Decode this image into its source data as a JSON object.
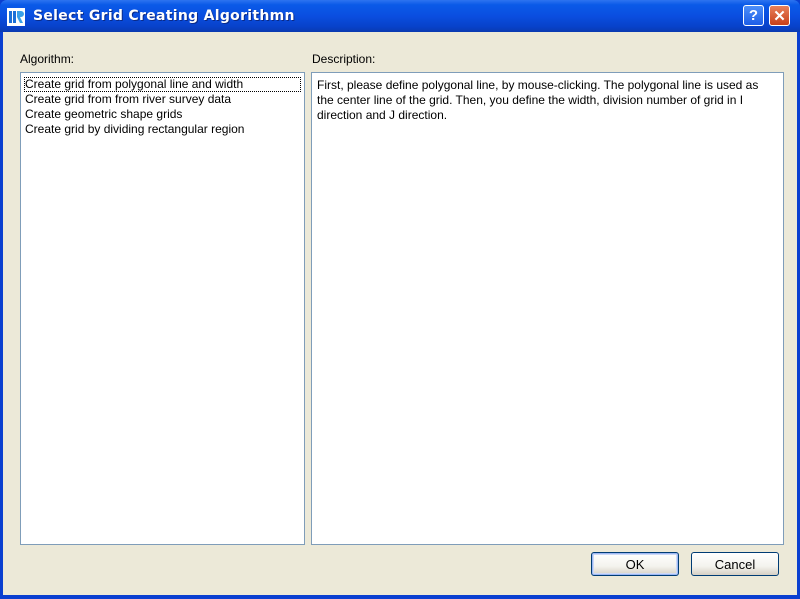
{
  "window": {
    "title": "Select Grid Creating Algorithmn",
    "help_label": "?",
    "close_label": "✕"
  },
  "labels": {
    "algorithm": "Algorithm:",
    "description": "Description:"
  },
  "algorithms": [
    {
      "label": "Create grid from polygonal line and width",
      "selected": true
    },
    {
      "label": "Create grid from from river survey data",
      "selected": false
    },
    {
      "label": "Create geometric shape grids",
      "selected": false
    },
    {
      "label": "Create grid by dividing rectangular region",
      "selected": false
    }
  ],
  "description_text": "First, please define polygonal line, by mouse-clicking. The polygonal line is used as the center line of the grid. Then, you define the width, division number of grid in I direction and J direction.",
  "buttons": {
    "ok": "OK",
    "cancel": "Cancel"
  },
  "colors": {
    "titlebar": "#0a4ee0",
    "client_bg": "#ece9d8",
    "border": "#7f9db9"
  },
  "icons": {
    "app": "app-logo-icon",
    "help": "help-icon",
    "close": "close-icon"
  }
}
